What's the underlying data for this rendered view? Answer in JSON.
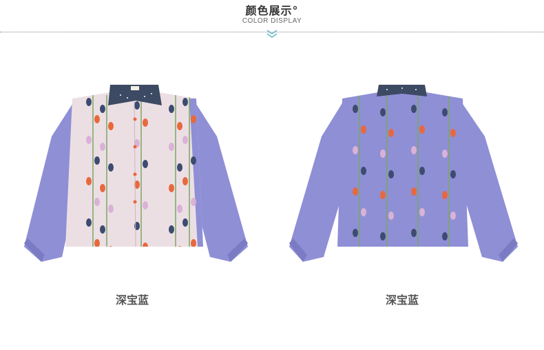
{
  "header": {
    "title": "颜色展示°",
    "subtitle": "COLOR DISPLAY"
  },
  "products": [
    {
      "view": "front",
      "color_label": "深宝蓝"
    },
    {
      "view": "back",
      "color_label": "深宝蓝"
    }
  ],
  "colors": {
    "sleeve_blue": "#8f8fd6",
    "front_pink": "#ecdfe4",
    "collar_navy": "#3d4a63",
    "tulip_orange": "#e8683d",
    "tulip_navy": "#3e4b70",
    "tulip_pink": "#d9b2d6",
    "stem_green": "#7aa763"
  }
}
